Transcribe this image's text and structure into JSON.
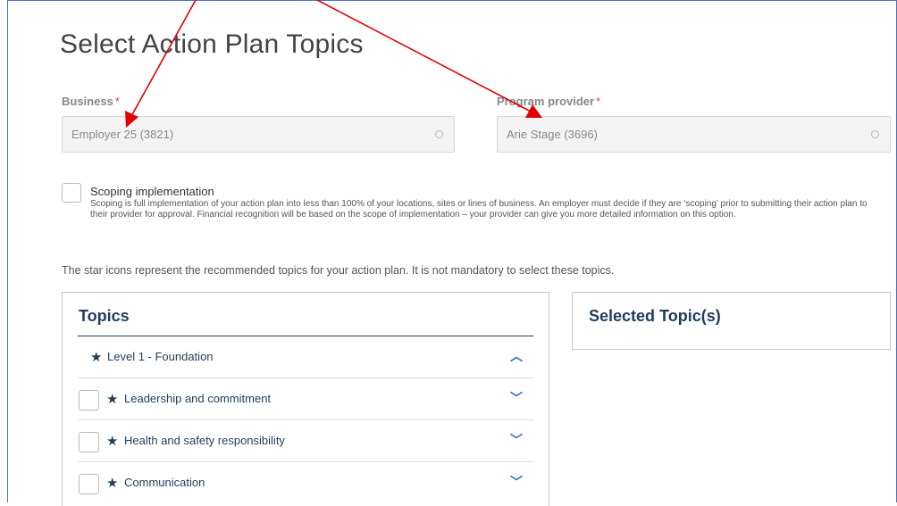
{
  "page": {
    "title": "Select Action Plan Topics"
  },
  "business": {
    "label": "Business",
    "required_mark": "*",
    "value": "Employer 25 (3821)"
  },
  "provider": {
    "label": "Program provider",
    "required_mark": "*",
    "value": "Arie Stage (3696)"
  },
  "scoping": {
    "label": "Scoping implementation",
    "checked": false,
    "description": "Scoping is full implementation of your action plan into less than 100% of your locations, sites or lines of business. An employer must decide if they are ‘scoping’ prior to submitting their action plan to their provider for approval. Financial recognition will be based on the scope of implementation – your provider can give you more detailed information on this option."
  },
  "star_note": "The star icons represent the recommended topics for your action plan. It is not mandatory to select these topics.",
  "topics": {
    "title": "Topics",
    "level": {
      "label": "Level 1 - Foundation",
      "expanded": true
    },
    "items": [
      {
        "label": "Leadership and commitment",
        "recommended": true,
        "checked": false
      },
      {
        "label": "Health and safety responsibility",
        "recommended": true,
        "checked": false
      },
      {
        "label": "Communication",
        "recommended": true,
        "checked": false
      }
    ]
  },
  "selected": {
    "title": "Selected Topic(s)"
  },
  "annotation": {
    "arrow_color": "#e00000"
  }
}
